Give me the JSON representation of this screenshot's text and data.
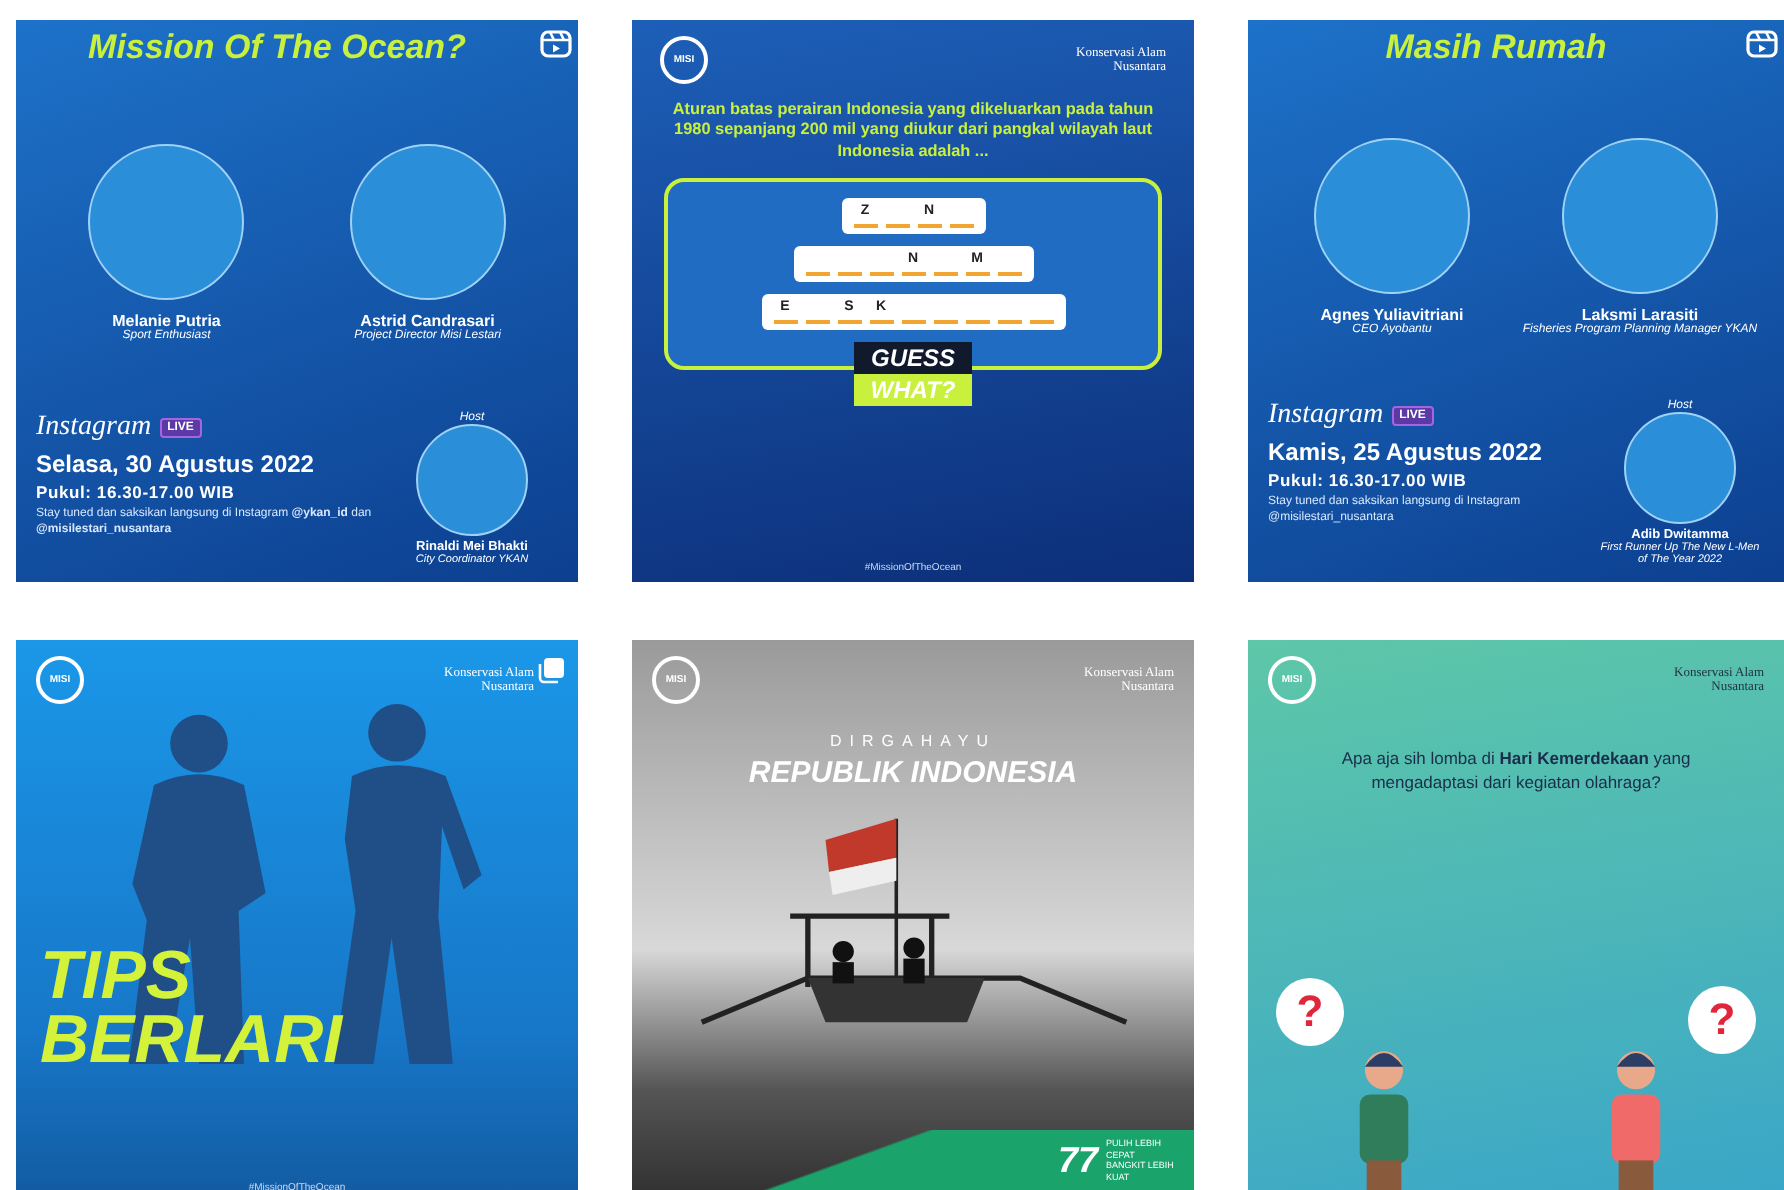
{
  "posts": [
    {
      "kind": "live",
      "title": "Mission Of The Ocean?",
      "guests": [
        {
          "name": "Melanie Putria",
          "role": "Sport Enthusiast"
        },
        {
          "name": "Astrid Candrasari",
          "role": "Project Director Misi Lestari"
        }
      ],
      "platform": "Instagram",
      "badge": "LIVE",
      "date": "Selasa, 30 Agustus 2022",
      "time": "Pukul: 16.30-17.00 WIB",
      "note": "Stay tuned dan saksikan langsung di Instagram **@ykan_id** dan **@misilestari_nusantara**",
      "host_label": "Host",
      "host": {
        "name": "Rinaldi Mei Bhakti",
        "role": "City Coordinator YKAN"
      }
    },
    {
      "kind": "quiz",
      "logo": "MISI",
      "org": "Konservasi Alam Nusantara",
      "question": "Aturan batas perairan Indonesia yang dikeluarkan pada tahun 1980 sepanjang 200 mil yang diukur dari pangkal wilayah laut Indonesia adalah ...",
      "rows": [
        [
          "Z",
          "",
          "N",
          ""
        ],
        [
          "",
          "",
          "",
          "N",
          "",
          "M",
          ""
        ],
        [
          "E",
          "",
          "S",
          "K",
          "",
          "",
          "",
          "",
          ""
        ]
      ],
      "guess": [
        "GUESS",
        "WHAT?"
      ],
      "hashtag": "#MissionOfTheOcean"
    },
    {
      "kind": "live",
      "title": "Masih Rumah",
      "guests": [
        {
          "name": "Agnes Yuliavitriani",
          "role": "CEO Ayobantu"
        },
        {
          "name": "Laksmi Larasiti",
          "role": "Fisheries Program Planning Manager YKAN"
        }
      ],
      "platform": "Instagram",
      "badge": "LIVE",
      "date": "Kamis, 25 Agustus 2022",
      "time": "Pukul: 16.30-17.00 WIB",
      "note": "Stay tuned dan saksikan langsung di Instagram @misilestari_nusantara",
      "host_label": "Host",
      "host": {
        "name": "Adib Dwitamma",
        "role": "First Runner Up The New L-Men of The Year 2022"
      }
    },
    {
      "kind": "tips",
      "logo": "MISI",
      "org": "Konservasi Alam Nusantara",
      "title": [
        "TIPS",
        "BERLARI"
      ],
      "hashtag": "#MissionOfTheOcean"
    },
    {
      "kind": "photo",
      "logo": "MISI",
      "org": "Konservasi Alam Nusantara",
      "kicker": "DIRGAHAYU",
      "title": "REPUBLIK INDONESIA",
      "emblem": "77",
      "tagline": "PULIH LEBIH CEPAT BANGKIT LEBIH KUAT"
    },
    {
      "kind": "illustration",
      "logo": "MISI",
      "org": "Konservasi Alam Nusantara",
      "question": "Apa aja sih lomba di **Hari Kemerdekaan** yang mengadaptasi dari kegiatan olahraga?",
      "bubbles": [
        "?",
        "?"
      ]
    }
  ]
}
